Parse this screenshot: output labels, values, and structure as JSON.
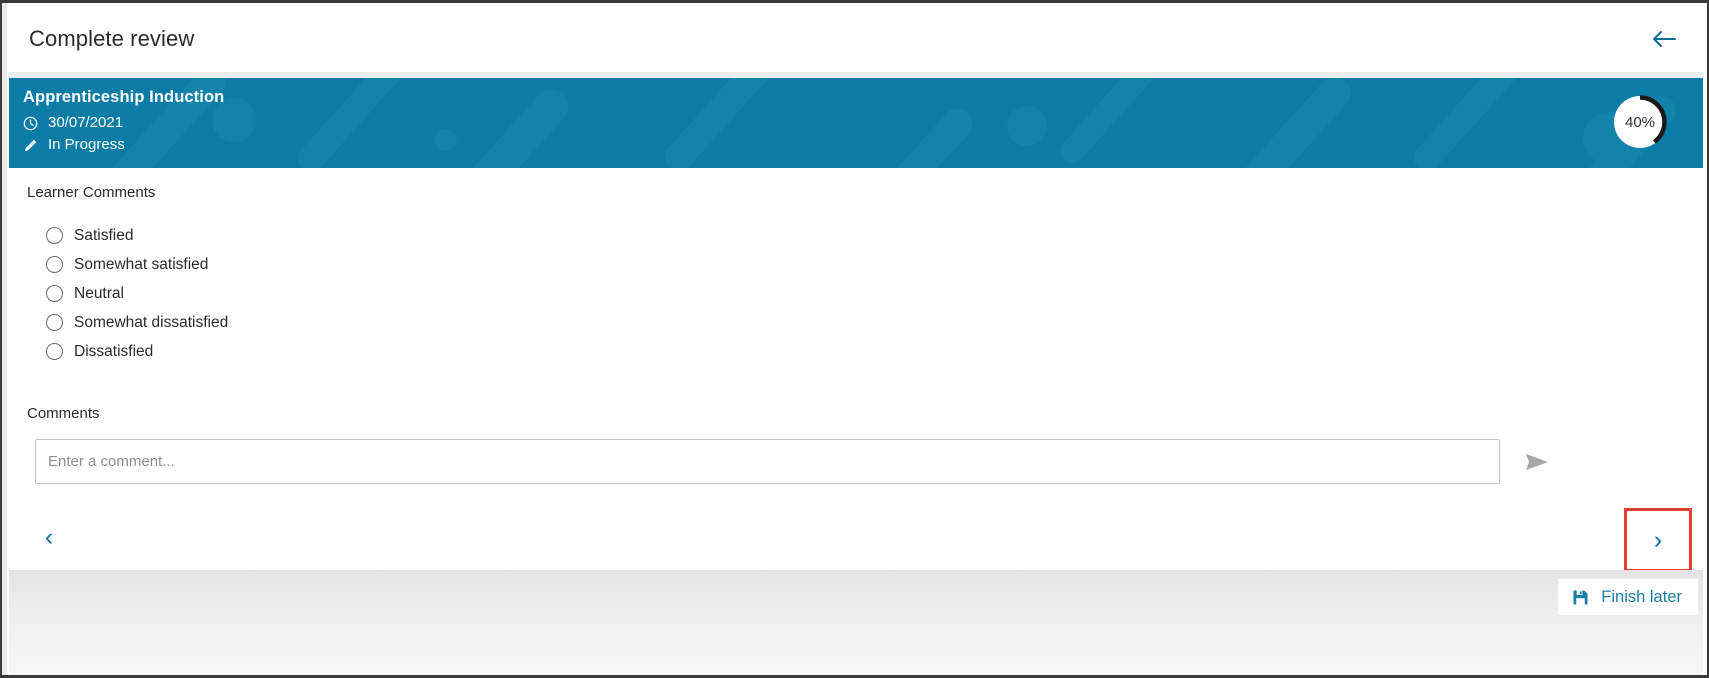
{
  "header": {
    "title": "Complete review",
    "back_icon": "arrow-left-icon"
  },
  "banner": {
    "title": "Apprenticeship Induction",
    "date": "30/07/2021",
    "date_icon": "clock-icon",
    "status": "In Progress",
    "status_icon": "pencil-icon",
    "progress_percent": "40%",
    "progress_value": 40,
    "background_color": "#0b7ca6"
  },
  "form": {
    "section_label": "Learner Comments",
    "options": [
      {
        "label": "Satisfied",
        "selected": false
      },
      {
        "label": "Somewhat satisfied",
        "selected": false
      },
      {
        "label": "Neutral",
        "selected": false
      },
      {
        "label": "Somewhat dissatisfied",
        "selected": false
      },
      {
        "label": "Dissatisfied",
        "selected": false
      }
    ],
    "comments_label": "Comments",
    "comment_placeholder": "Enter a comment...",
    "comment_value": "",
    "send_icon": "send-icon"
  },
  "navigation": {
    "prev_label": "‹",
    "next_label": "›",
    "highlight_color": "#ee3b33"
  },
  "footer": {
    "finish_later_label": "Finish later",
    "finish_later_icon": "save-icon"
  },
  "colors": {
    "accent": "#0f6f9b",
    "banner": "#0b7ca6",
    "link": "#1b7ea6",
    "highlight": "#ee3b33"
  }
}
